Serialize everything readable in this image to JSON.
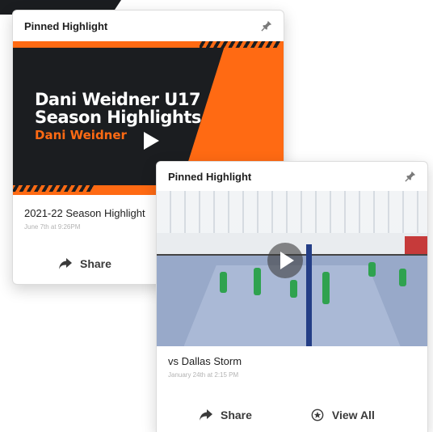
{
  "card1": {
    "header": {
      "title": "Pinned Highlight"
    },
    "thumbnail": {
      "line1": "Dani Weidner U17",
      "line2": "Season Highlights",
      "sub": "Dani Weidner"
    },
    "caption": {
      "title": "2021-22 Season Highlight",
      "subtitle": "June 7th at 9:26PM"
    },
    "actions": {
      "share": "Share"
    }
  },
  "card2": {
    "header": {
      "title": "Pinned Highlight"
    },
    "caption": {
      "title": "vs Dallas Storm",
      "subtitle": "January 24th at 2:15 PM"
    },
    "actions": {
      "share": "Share",
      "view_all": "View All"
    }
  },
  "icons": {
    "pin": "pin-icon",
    "play": "play-icon",
    "share": "share-arrow-icon",
    "view_all": "star-badge-icon"
  },
  "colors": {
    "accent": "#ff6a13",
    "dark": "#1b1d20",
    "text": "#1e1e1e"
  }
}
